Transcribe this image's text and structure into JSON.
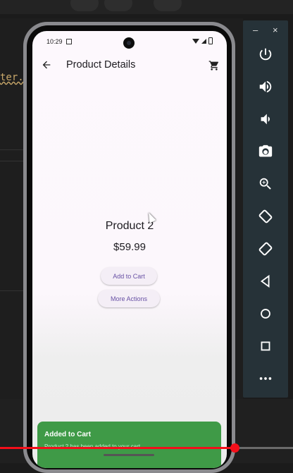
{
  "ide": {
    "code_fragment": "ter.c"
  },
  "phone": {
    "status": {
      "time": "10:29"
    },
    "app_bar": {
      "title": "Product Details"
    },
    "product": {
      "name": "Product 2",
      "price": "$59.99"
    },
    "buttons": {
      "add_to_cart": "Add to Cart",
      "more_actions": "More Actions"
    },
    "snackbar": {
      "title": "Added to Cart",
      "message": "Product 2 has been added to your cart"
    }
  },
  "emulator_panel": {
    "minimize_label": "–",
    "close_label": "×",
    "controls": [
      "power-icon",
      "volume-up-icon",
      "volume-down-icon",
      "camera-icon",
      "zoom-icon",
      "rotate-left-icon",
      "rotate-right-icon",
      "back-icon",
      "home-icon",
      "overview-icon",
      "more-icon"
    ]
  },
  "video": {
    "progress": 0.8
  },
  "colors": {
    "accent": "#6750a4",
    "snackbar": "#3f9a47",
    "progress": "#f30f1a",
    "panel": "#263238"
  }
}
